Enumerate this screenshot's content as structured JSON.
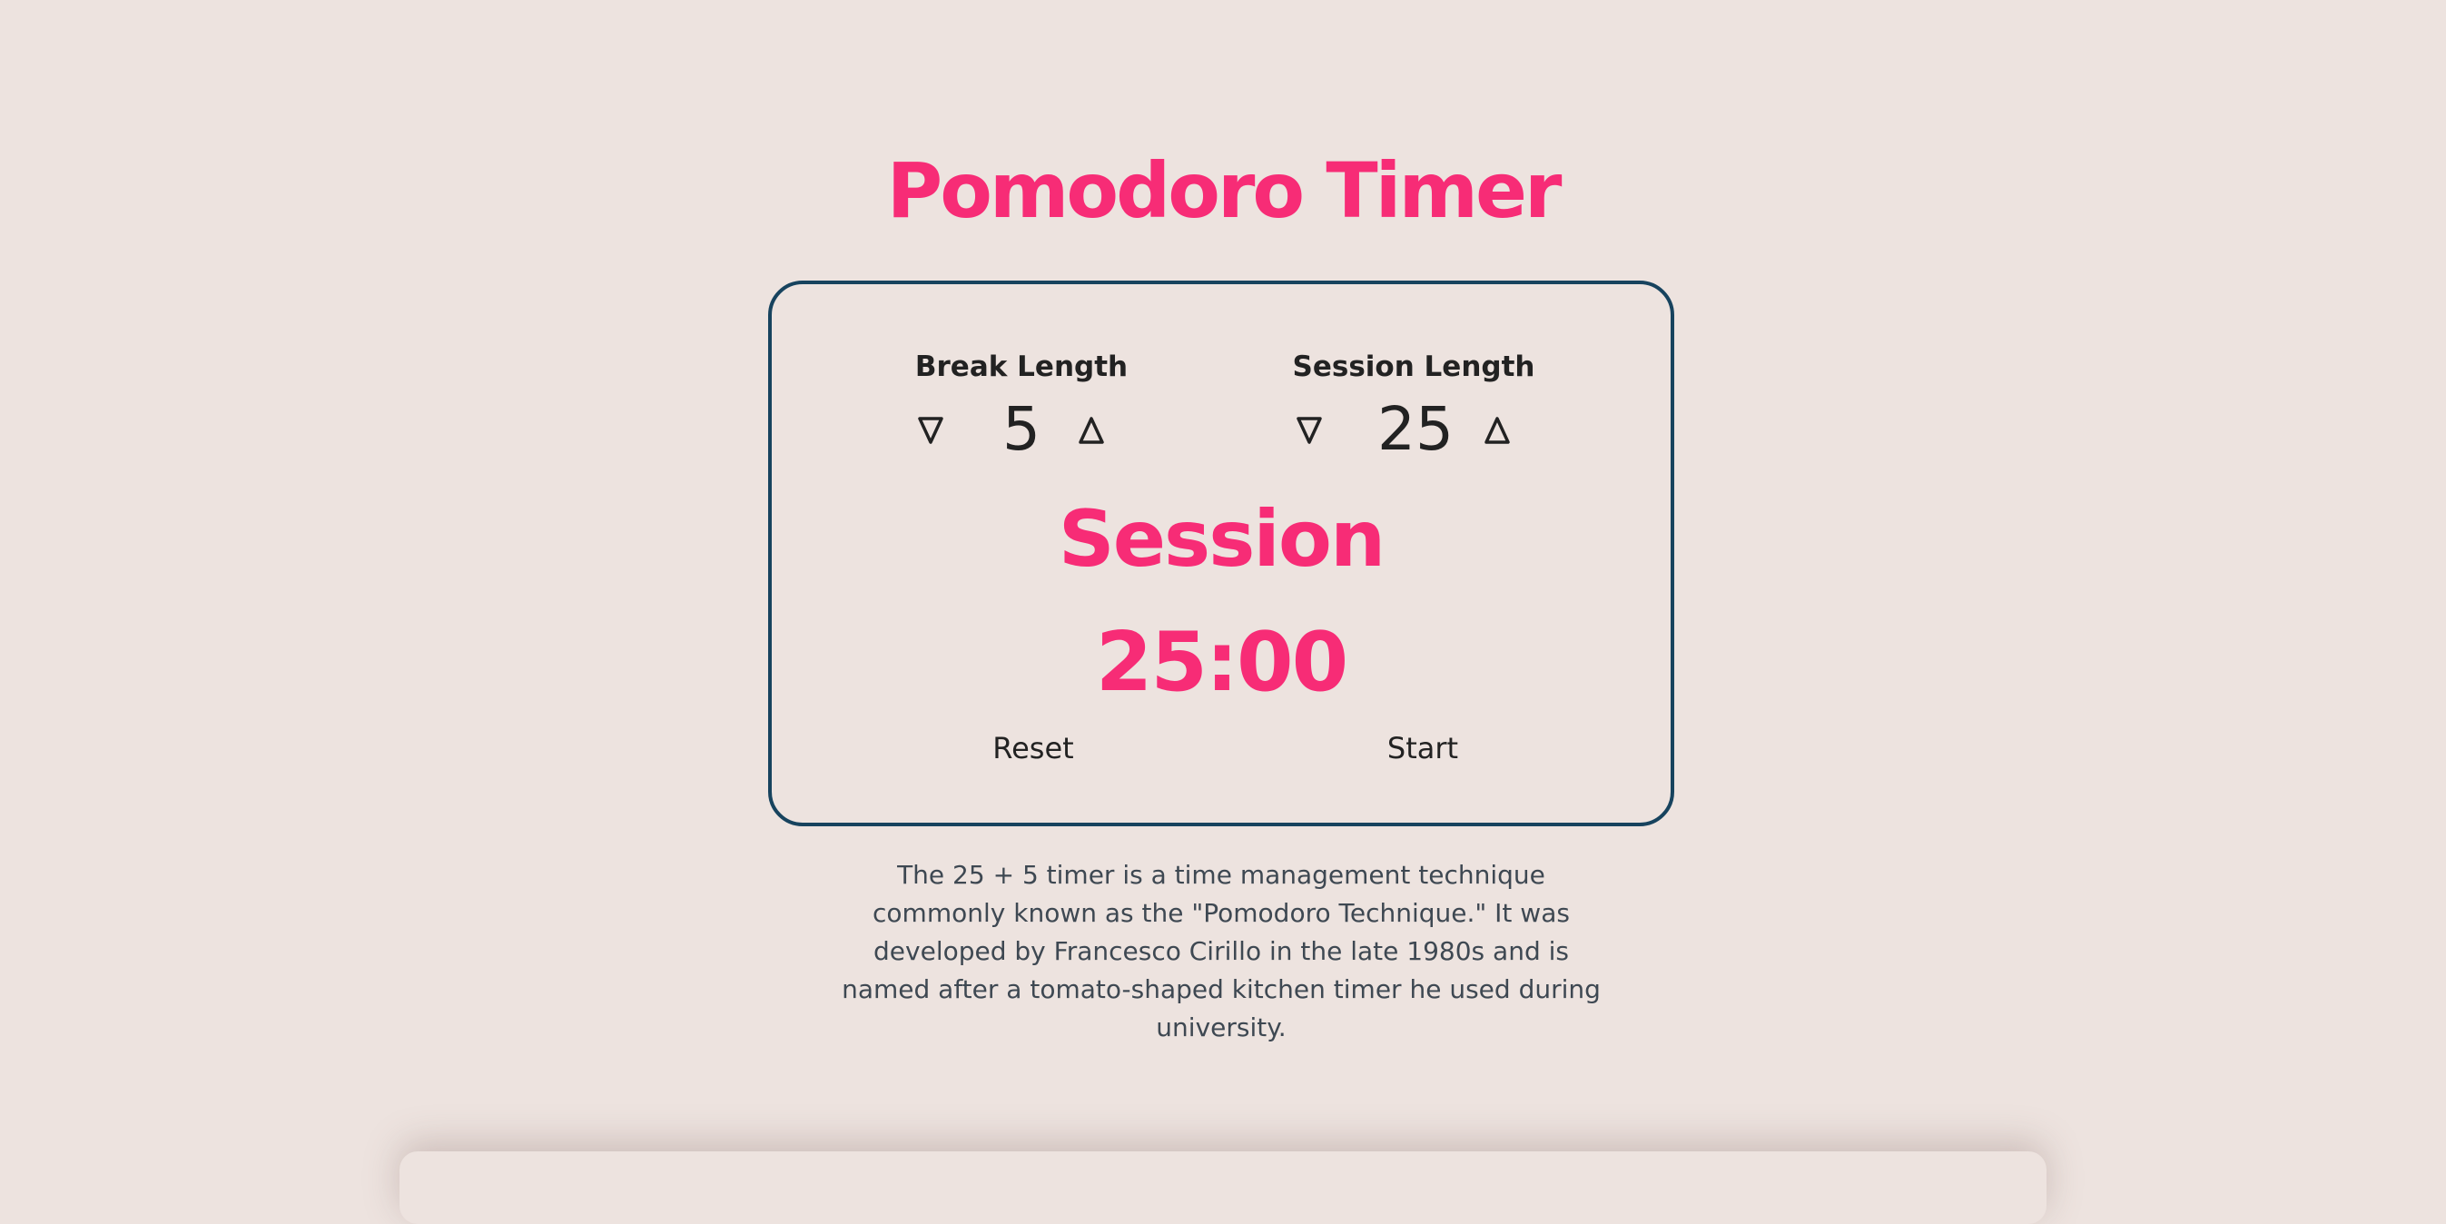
{
  "app": {
    "title": "Pomodoro Timer"
  },
  "break": {
    "label": "Break Length",
    "value": "5",
    "decrement_icon": "triangle-down-icon",
    "increment_icon": "triangle-up-icon"
  },
  "session": {
    "label": "Session Length",
    "value": "25",
    "decrement_icon": "triangle-down-icon",
    "increment_icon": "triangle-up-icon"
  },
  "timer": {
    "label": "Session",
    "time_left": "25:00"
  },
  "controls": {
    "reset_label": "Reset",
    "start_label": "Start"
  },
  "description": "The 25 + 5 timer is a time management technique commonly known as the \"Pomodoro Technique.\" It was developed by Francesco Cirillo in the late 1980s and is named after a tomato-shaped kitchen timer he used during university.",
  "colors": {
    "background": "#ede3df",
    "accent": "#f72c76",
    "card_border": "#17435e",
    "text": "#222222",
    "description_text": "#3e4852"
  }
}
